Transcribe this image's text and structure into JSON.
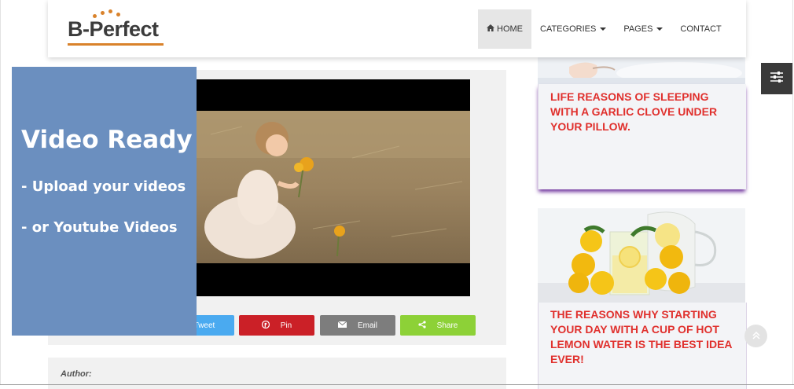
{
  "header": {
    "logo_text": "B-Perfect",
    "nav": [
      {
        "label": "HOME",
        "icon": "home-icon",
        "active": true
      },
      {
        "label": "CATEGORIES",
        "dropdown": true
      },
      {
        "label": "PAGES",
        "dropdown": true
      },
      {
        "label": "CONTACT"
      }
    ]
  },
  "promo": {
    "title": "Video Ready",
    "line1": "- Upload your videos",
    "line2": "- or Youtube Videos"
  },
  "share": {
    "tweet": "Tweet",
    "pin": "Pin",
    "email": "Email",
    "share": "Share"
  },
  "post": {
    "author_label": "Author:"
  },
  "sidebar": {
    "card1_title": "LIFE REASONS OF SLEEPING WITH A GARLIC CLOVE UNDER YOUR PILLOW.",
    "card2_title": "THE REASONS WHY STARTING YOUR DAY WITH A CUP OF HOT LEMON WATER IS THE BEST IDEA EVER!"
  },
  "colors": {
    "tweet": "#4aaaf0",
    "pin": "#cb2027",
    "email": "#7d7d7d",
    "share": "#8dd137",
    "promo_bg": "#6b8fbf",
    "card_title": "#e0302d",
    "card_shadow": "#6a2c99"
  }
}
